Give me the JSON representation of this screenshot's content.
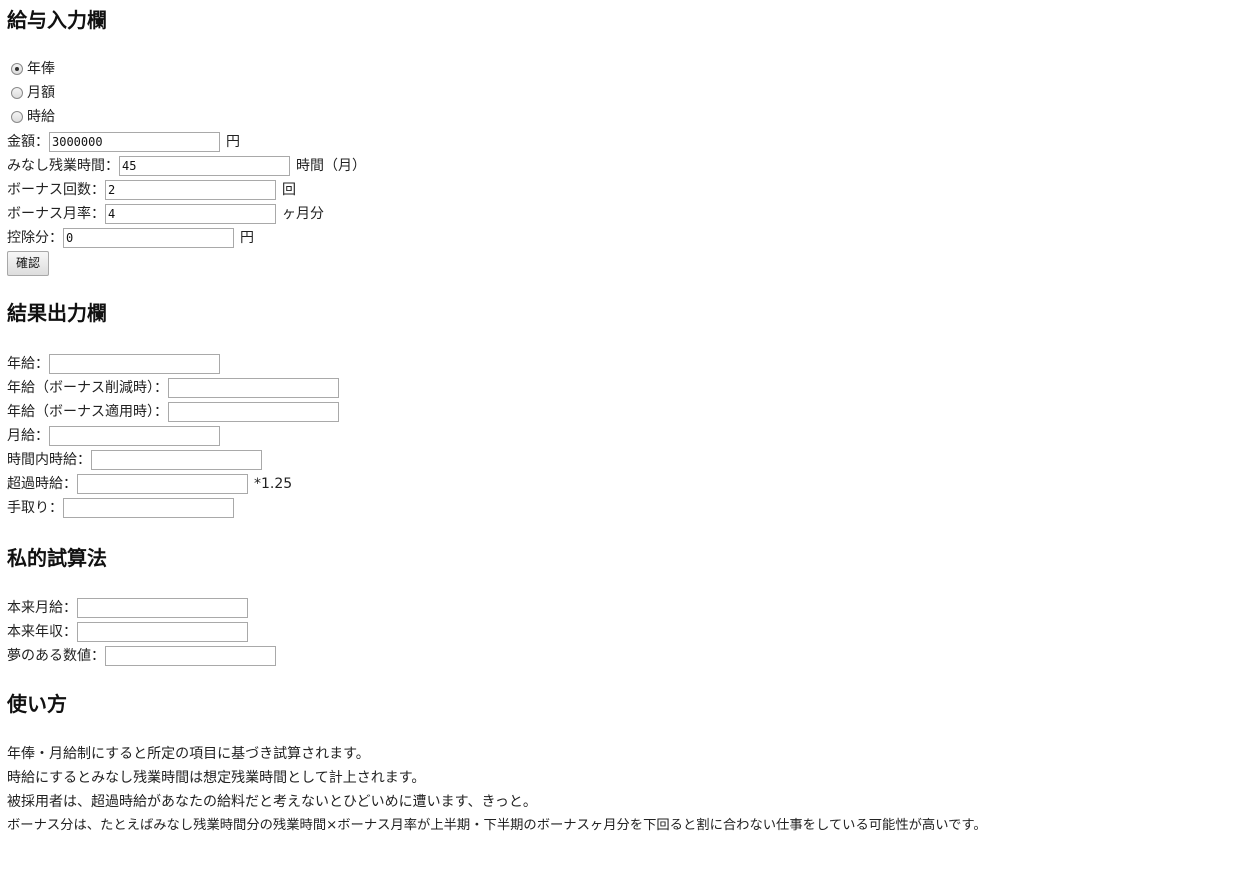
{
  "input_section": {
    "heading": "給与入力欄",
    "pay_type_options": [
      {
        "label": "年俸",
        "checked": true
      },
      {
        "label": "月額",
        "checked": false
      },
      {
        "label": "時給",
        "checked": false
      }
    ],
    "amount": {
      "label": "金額：",
      "value": "3000000",
      "unit": "円"
    },
    "overtime_hours": {
      "label": "みなし残業時間：",
      "value": "45",
      "unit": "時間（月）"
    },
    "bonus_count": {
      "label": "ボーナス回数：",
      "value": "2",
      "unit": "回"
    },
    "bonus_rate": {
      "label": "ボーナス月率：",
      "value": "4",
      "unit": "ヶ月分"
    },
    "deduction": {
      "label": "控除分：",
      "value": "0",
      "unit": "円"
    },
    "confirm_button": "確認"
  },
  "result_section": {
    "heading": "結果出力欄",
    "annual": {
      "label": "年給：",
      "value": ""
    },
    "annual_bonus_cut": {
      "label": "年給（ボーナス削減時）：",
      "value": ""
    },
    "annual_bonus_applied": {
      "label": "年給（ボーナス適用時）：",
      "value": ""
    },
    "monthly": {
      "label": "月給：",
      "value": ""
    },
    "hourly_regular": {
      "label": "時間内時給：",
      "value": ""
    },
    "hourly_overtime": {
      "label": "超過時給：",
      "value": "",
      "suffix": "*1.25"
    },
    "take_home": {
      "label": "手取り：",
      "value": ""
    }
  },
  "private_section": {
    "heading": "私的試算法",
    "true_monthly": {
      "label": "本来月給：",
      "value": ""
    },
    "true_annual": {
      "label": "本来年収：",
      "value": ""
    },
    "dream_value": {
      "label": "夢のある数値：",
      "value": ""
    }
  },
  "usage_section": {
    "heading": "使い方",
    "lines": [
      "年俸・月給制にすると所定の項目に基づき試算されます。",
      "時給にするとみなし残業時間は想定残業時間として計上されます。",
      "被採用者は、超過時給があなたの給料だと考えないとひどいめに遭います、きっと。",
      "ボーナス分は、たとえばみなし残業時間分の残業時間×ボーナス月率が上半期・下半期のボーナスヶ月分を下回ると割に合わない仕事をしている可能性が高いです。"
    ]
  }
}
